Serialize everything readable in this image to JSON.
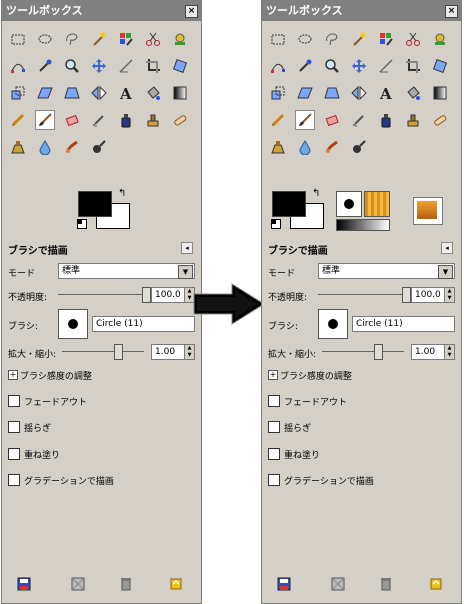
{
  "window_title": "ツールボックス",
  "close_glyph": "×",
  "tool_icons": [
    "rect-select-icon",
    "ellipse-select-icon",
    "free-select-icon",
    "fuzzy-select-icon",
    "color-select-icon",
    "scissors-icon",
    "foreground-select-icon",
    "paths-icon",
    "color-picker-icon",
    "zoom-icon",
    "move-icon",
    "measure-icon",
    "crop-icon",
    "rotate-icon",
    "scale-icon",
    "shear-icon",
    "perspective-icon",
    "flip-icon",
    "text-icon",
    "bucket-fill-icon",
    "blend-icon",
    "pencil-icon",
    "paintbrush-icon",
    "eraser-icon",
    "airbrush-icon",
    "ink-icon",
    "clone-icon",
    "heal-icon",
    "perspective-clone-icon",
    "blur-icon",
    "smudge-icon",
    "dodge-burn-icon"
  ],
  "colors": {
    "foreground": "#000000",
    "background": "#ffffff",
    "panel": "#d4d0c8",
    "title_bg": "#808080"
  },
  "tool_options": {
    "header": "ブラシで描画",
    "mode_label": "モード",
    "mode_value": "標準",
    "opacity_label": "不透明度:",
    "opacity_value": "100.0",
    "brush_label": "ブラシ:",
    "brush_name": "Circle (11)",
    "scale_label": "拡大・縮小:",
    "scale_value": "1.00",
    "pressure_label": "ブラシ感度の調整",
    "expander_glyph": "+",
    "fade_out": "フェードアウト",
    "jitter": "揺らぎ",
    "incremental": "重ね塗り",
    "gradient": "グラデーションで描画"
  },
  "bottom_icons": [
    "save-options-icon",
    "restore-options-icon",
    "delete-options-icon",
    "reset-options-icon"
  ]
}
